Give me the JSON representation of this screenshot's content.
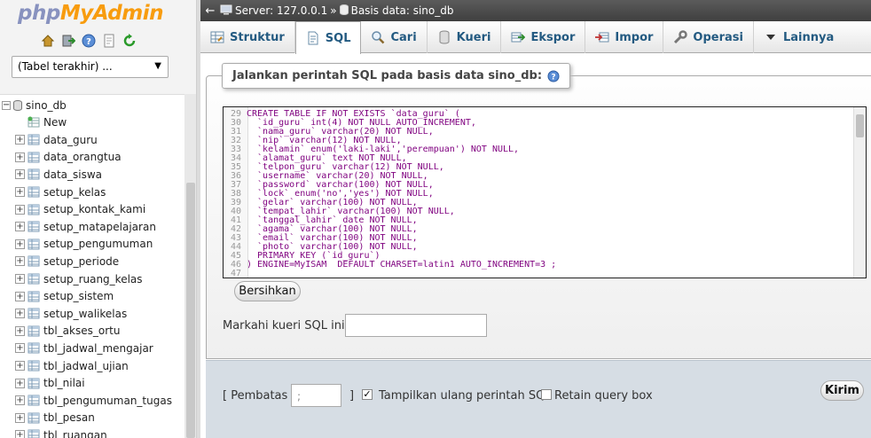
{
  "nav": {
    "logo_php": "php",
    "logo_my": "MyAdmin",
    "icons": [
      "home-icon",
      "exit-icon",
      "help-icon",
      "docs-icon",
      "reload-icon"
    ],
    "recent_label": "(Tabel terakhir) ...",
    "db_name": "sino_db",
    "new_label": "New",
    "tables": [
      "data_guru",
      "data_orangtua",
      "data_siswa",
      "setup_kelas",
      "setup_kontak_kami",
      "setup_matapelajaran",
      "setup_pengumuman",
      "setup_periode",
      "setup_ruang_kelas",
      "setup_sistem",
      "setup_walikelas",
      "tbl_akses_ortu",
      "tbl_jadwal_mengajar",
      "tbl_jadwal_ujian",
      "tbl_nilai",
      "tbl_pengumuman_tugas",
      "tbl_pesan",
      "tbl_ruangan"
    ]
  },
  "topbar": {
    "server": "Server: 127.0.0.1",
    "separator": "»",
    "database": "Basis data: sino_db"
  },
  "tabs": [
    {
      "label": "Struktur",
      "icon": "structure-icon"
    },
    {
      "label": "SQL",
      "icon": "sql-icon",
      "active": true
    },
    {
      "label": "Cari",
      "icon": "search-icon"
    },
    {
      "label": "Kueri",
      "icon": "query-icon"
    },
    {
      "label": "Ekspor",
      "icon": "export-icon"
    },
    {
      "label": "Impor",
      "icon": "import-icon"
    },
    {
      "label": "Operasi",
      "icon": "wrench-icon"
    },
    {
      "label": "Lainnya",
      "icon": "dropdown-arrow-icon"
    }
  ],
  "sql": {
    "legend": "Jalankan perintah SQL pada basis data sino_db:",
    "lines": [
      {
        "n": "29",
        "t": "CREATE TABLE IF NOT EXISTS `data_guru` ("
      },
      {
        "n": "30",
        "t": "  `id_guru` int(4) NOT NULL AUTO_INCREMENT,"
      },
      {
        "n": "31",
        "t": "  `nama_guru` varchar(20) NOT NULL,"
      },
      {
        "n": "32",
        "t": "  `nip` varchar(12) NOT NULL,"
      },
      {
        "n": "33",
        "t": "  `kelamin` enum('laki-laki','perempuan') NOT NULL,"
      },
      {
        "n": "34",
        "t": "  `alamat_guru` text NOT NULL,"
      },
      {
        "n": "35",
        "t": "  `telpon_guru` varchar(12) NOT NULL,"
      },
      {
        "n": "36",
        "t": "  `username` varchar(20) NOT NULL,"
      },
      {
        "n": "37",
        "t": "  `password` varchar(100) NOT NULL,"
      },
      {
        "n": "38",
        "t": "  `lock` enum('no','yes') NOT NULL,"
      },
      {
        "n": "39",
        "t": "  `gelar` varchar(100) NOT NULL,"
      },
      {
        "n": "40",
        "t": "  `tempat_lahir` varchar(100) NOT NULL,"
      },
      {
        "n": "41",
        "t": "  `tanggal_lahir` date NOT NULL,"
      },
      {
        "n": "42",
        "t": "  `agama` varchar(100) NOT NULL,"
      },
      {
        "n": "43",
        "t": "  `email` varchar(100) NOT NULL,"
      },
      {
        "n": "44",
        "t": "  `photo` varchar(100) NOT NULL,"
      },
      {
        "n": "45",
        "t": "  PRIMARY KEY (`id_guru`)"
      },
      {
        "n": "46",
        "t": ") ENGINE=MyISAM  DEFAULT CHARSET=latin1 AUTO_INCREMENT=3 ;"
      },
      {
        "n": "47",
        "t": ""
      }
    ],
    "clear_button": "Bersihkan",
    "bookmark_label": "Markahi kueri SQL ini:",
    "bookmark_value": ""
  },
  "footer": {
    "delimiter_open": "[ Pembatas",
    "delimiter_value": ";",
    "delimiter_close": "]",
    "show_query_label": "Tampilkan ulang perintah SQL",
    "show_query_checked": true,
    "retain_label": "Retain query box",
    "retain_checked": false,
    "submit_label": "Kirim"
  }
}
